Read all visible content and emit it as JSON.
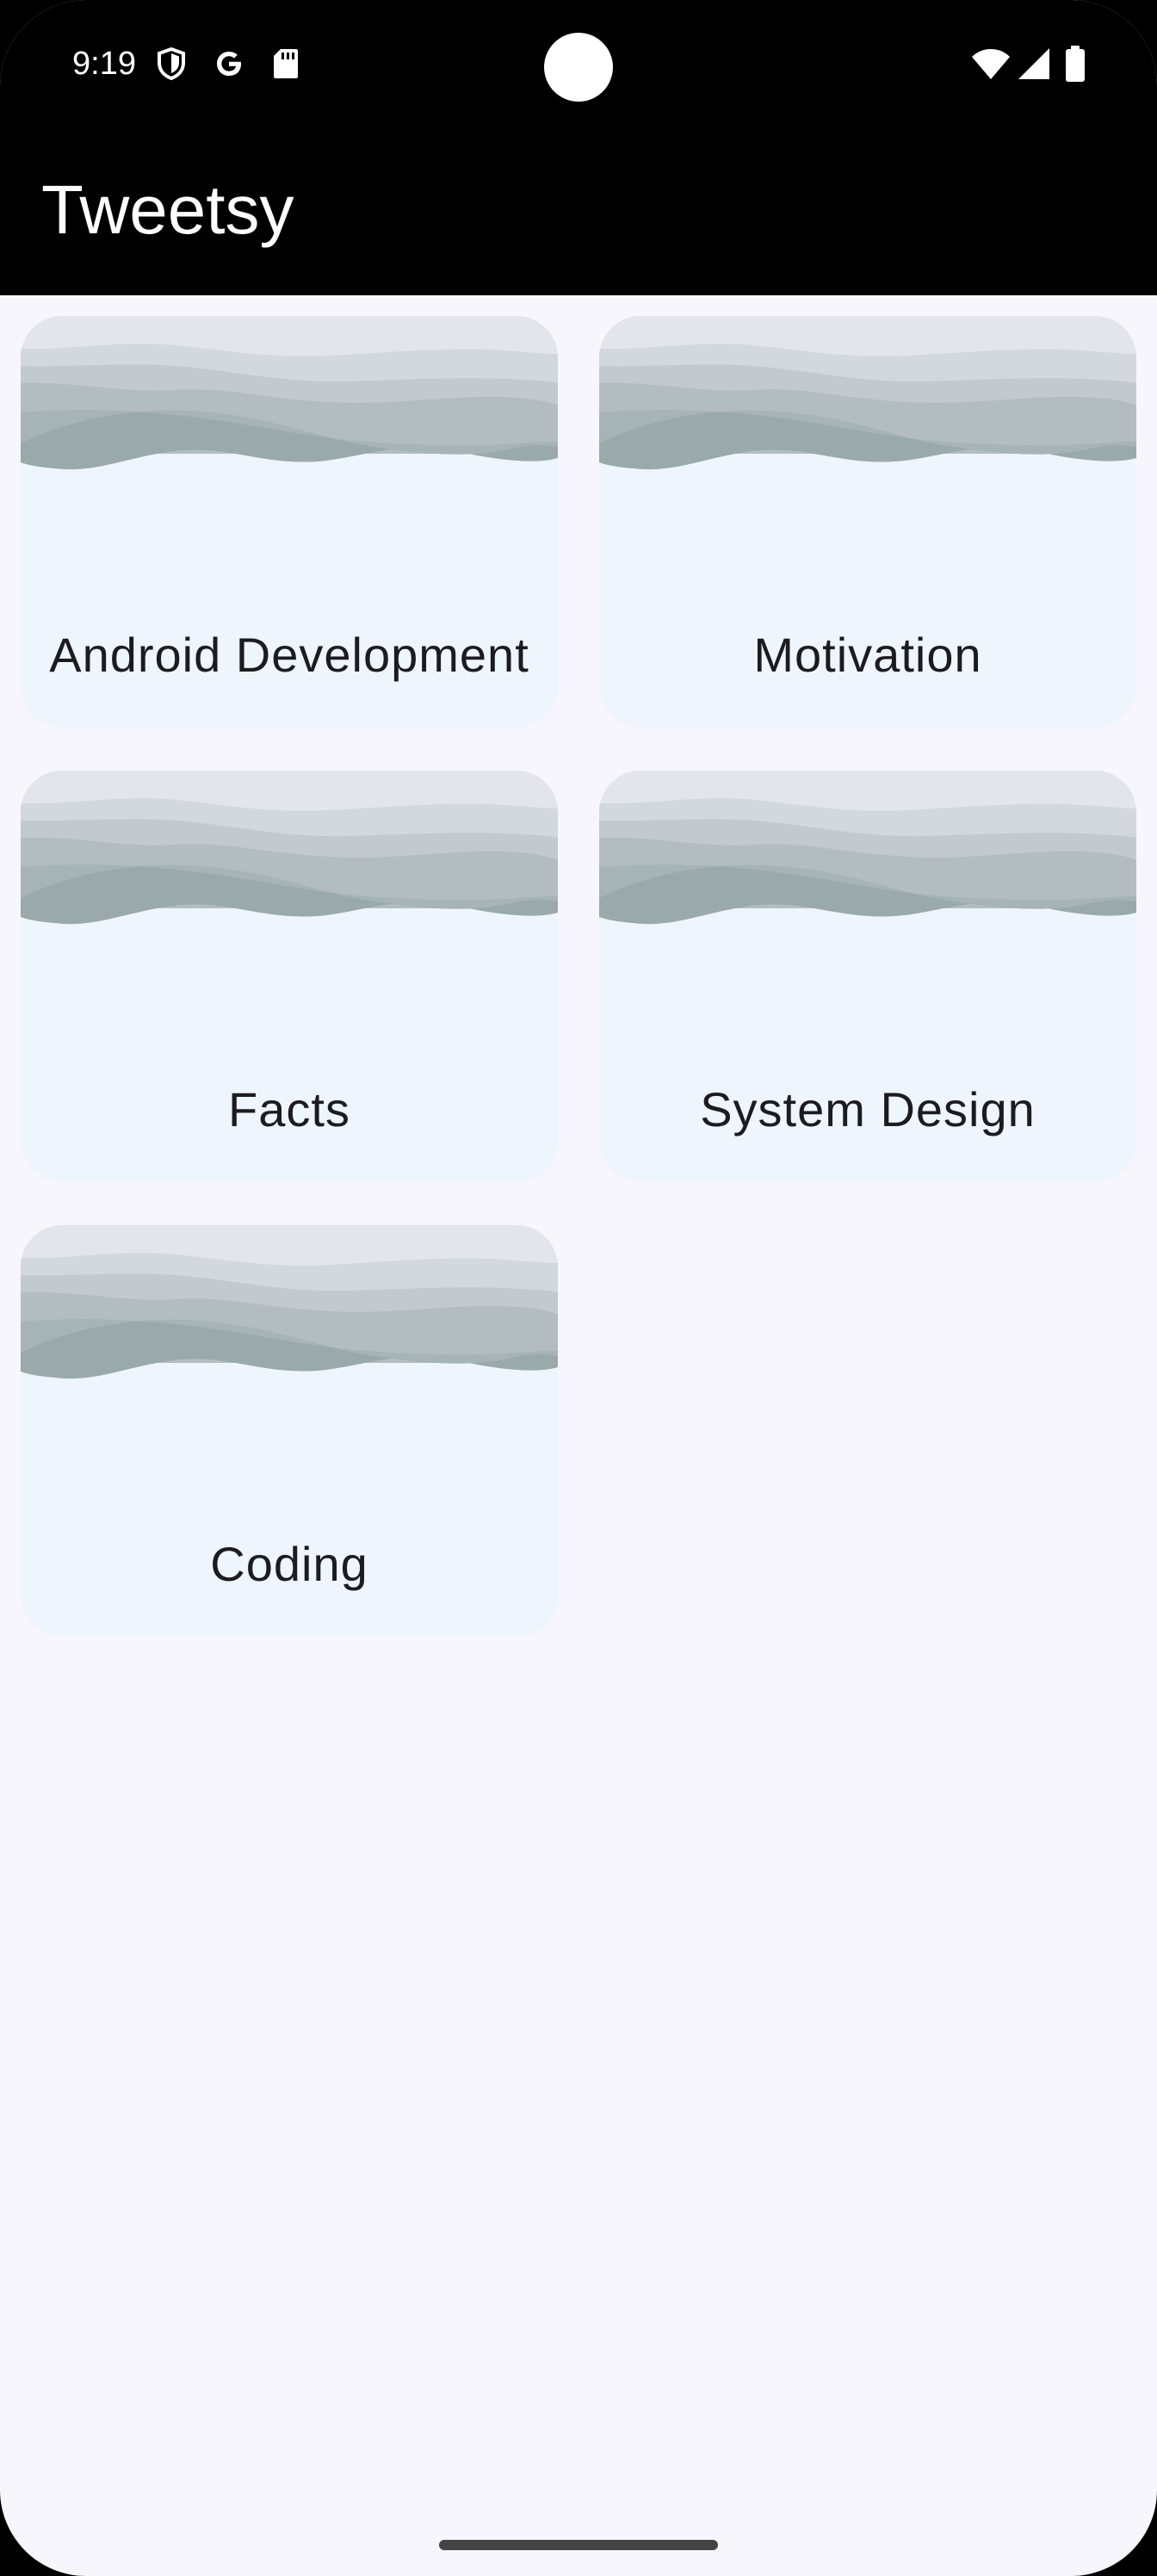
{
  "status_bar": {
    "time": "9:19",
    "left_icons": [
      "shield-icon",
      "google-icon",
      "sd-card-icon"
    ],
    "right_icons": [
      "wifi-icon",
      "cellular-signal-icon",
      "battery-icon"
    ]
  },
  "app_bar": {
    "title": "Tweetsy"
  },
  "categories": [
    {
      "label": "Android Development"
    },
    {
      "label": "Motivation"
    },
    {
      "label": "Facts"
    },
    {
      "label": "System Design"
    },
    {
      "label": "Coding"
    }
  ],
  "colors": {
    "top_bar": "#000000",
    "background": "#f7f6fc",
    "card": "#eef5fd",
    "text": "#1c1b1f"
  }
}
